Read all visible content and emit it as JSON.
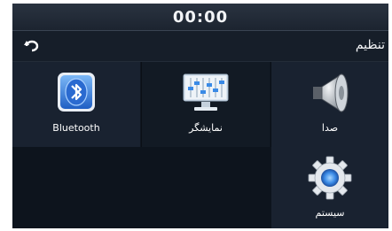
{
  "status": {
    "clock": "00:00"
  },
  "header": {
    "title": "تنظیم",
    "back_icon": "back-arrow-icon"
  },
  "tiles": [
    {
      "label": "Bluetooth",
      "icon": "bluetooth-icon"
    },
    {
      "label": "نمایشگر",
      "icon": "display-icon"
    },
    {
      "label": "صدا",
      "icon": "speaker-icon"
    },
    {
      "label": "سیستم",
      "icon": "gear-icon"
    }
  ],
  "colors": {
    "accent_blue": "#3a8ae6",
    "background": "#0f1620"
  }
}
